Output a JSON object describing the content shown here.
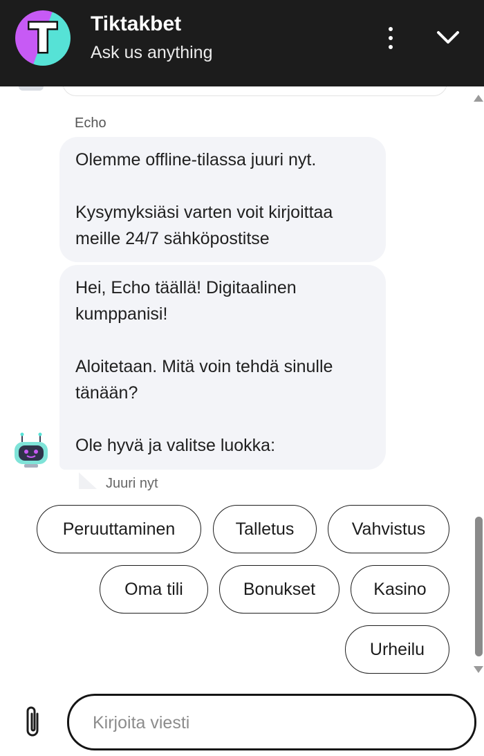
{
  "header": {
    "logo_letter": "T",
    "title": "Tiktakbet",
    "subtitle": "Ask us anything",
    "menu_icon": "more-vertical-icon",
    "collapse_icon": "chevron-down-icon",
    "background_color": "#1c1c1c",
    "logo_colors": [
      "#c75af5",
      "#56e2d6"
    ]
  },
  "messages": {
    "sender": "Echo",
    "bubble1": {
      "line1": "Olemme offline-tilassa juuri nyt.",
      "line2": "Kysymyksiäsi varten voit kirjoittaa meille 24/7 sähköpostitse"
    },
    "bubble2": {
      "line1": "Hei, Echo täällä! Digitaalinen kumppanisi!",
      "line2": "Aloitetaan. Mitä voin tehdä sinulle tänään?",
      "line3": "Ole hyvä ja valitse luokka:"
    },
    "timestamp": "Juuri nyt",
    "bubble_color": "#f3f4f8"
  },
  "quick_replies": [
    "Peruuttaminen",
    "Talletus",
    "Vahvistus",
    "Oma tili",
    "Bonukset",
    "Kasino",
    "Urheilu"
  ],
  "composer": {
    "attach_icon": "paperclip-icon",
    "placeholder": "Kirjoita viesti"
  }
}
